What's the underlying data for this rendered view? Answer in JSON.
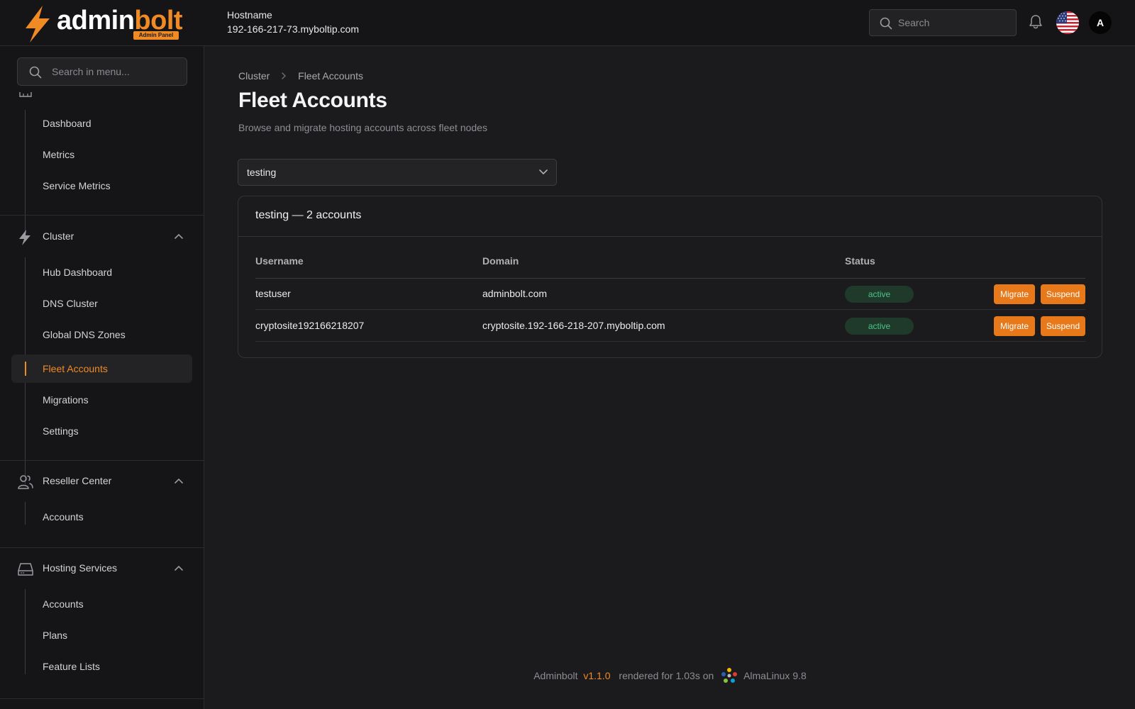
{
  "header": {
    "logo_primary": "admin",
    "logo_accent": "bolt",
    "logo_badge": "Admin Panel",
    "hostname_label": "Hostname",
    "hostname_value": "192-166-217-73.myboltip.com",
    "search_placeholder": "Search",
    "avatar_initial": "A",
    "language_flag": "us-flag-icon"
  },
  "sidebar": {
    "search_placeholder": "Search in menu...",
    "overview_items": [
      "Dashboard",
      "Metrics",
      "Service Metrics"
    ],
    "sections": [
      {
        "title": "Cluster",
        "icon": "bolt-icon",
        "expanded": true,
        "items": [
          "Hub Dashboard",
          "DNS Cluster",
          "Global DNS Zones",
          "Fleet Accounts",
          "Migrations",
          "Settings"
        ],
        "active": "Fleet Accounts"
      },
      {
        "title": "Reseller Center",
        "icon": "users-icon",
        "expanded": true,
        "items": [
          "Accounts"
        ]
      },
      {
        "title": "Hosting Services",
        "icon": "server-icon",
        "expanded": true,
        "items": [
          "Accounts",
          "Plans",
          "Feature Lists"
        ]
      }
    ]
  },
  "main": {
    "breadcrumb": [
      "Cluster",
      "Fleet Accounts"
    ],
    "title": "Fleet Accounts",
    "subtitle": "Browse and migrate hosting accounts across fleet nodes",
    "node_select": {
      "value": "testing"
    },
    "card_title": "testing — 2 accounts",
    "table": {
      "columns": [
        "Username",
        "Domain",
        "Status"
      ],
      "rows": [
        {
          "username": "testuser",
          "domain": "adminbolt.com",
          "status": "active"
        },
        {
          "username": "cryptosite192166218207",
          "domain": "cryptosite.192-166-218-207.myboltip.com",
          "status": "active"
        }
      ],
      "actions": {
        "migrate": "Migrate",
        "suspend": "Suspend"
      }
    }
  },
  "footer": {
    "app": "Adminbolt",
    "version": "v1.1.0",
    "render_text": "rendered for 1.03s on",
    "os": "AlmaLinux 9.8"
  },
  "colors": {
    "accent": "#f08a24",
    "button": "#e8791a",
    "status_active_bg": "#1f3a2a",
    "status_active_text": "#4cc38a",
    "background": "#1b1b1d",
    "panel": "#151517"
  }
}
